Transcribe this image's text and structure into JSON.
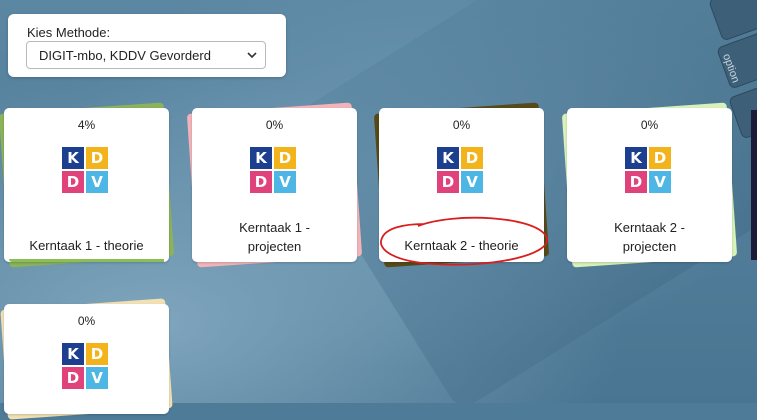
{
  "method": {
    "label": "Kies Methode:",
    "selected": "DIGIT-mbo, KDDV Gevorderd"
  },
  "logo": {
    "letters": [
      "K",
      "D",
      "D",
      "V"
    ],
    "colors": [
      "#1d3f8f",
      "#f2b31b",
      "#e0427b",
      "#4eb6e4"
    ]
  },
  "background": {
    "key_label": "option"
  },
  "cards": [
    {
      "percent": "4%",
      "progress": 0.04,
      "title_line1": "Kerntaak 1 - theorie",
      "title_line2": "",
      "accent": "#8bb35a"
    },
    {
      "percent": "0%",
      "progress": 0,
      "title_line1": "Kerntaak 1 -",
      "title_line2": "projecten",
      "accent": "#f2b4b9"
    },
    {
      "percent": "0%",
      "progress": 0,
      "title_line1": "Kerntaak 2 - theorie",
      "title_line2": "",
      "accent": "#554a18"
    },
    {
      "percent": "0%",
      "progress": 0,
      "title_line1": "Kerntaak 2 -",
      "title_line2": "projecten",
      "accent": "#d8f2b9"
    },
    {
      "percent": "0%",
      "progress": 0,
      "title_line1": "",
      "title_line2": "",
      "accent": "#f3dfb4"
    }
  ]
}
